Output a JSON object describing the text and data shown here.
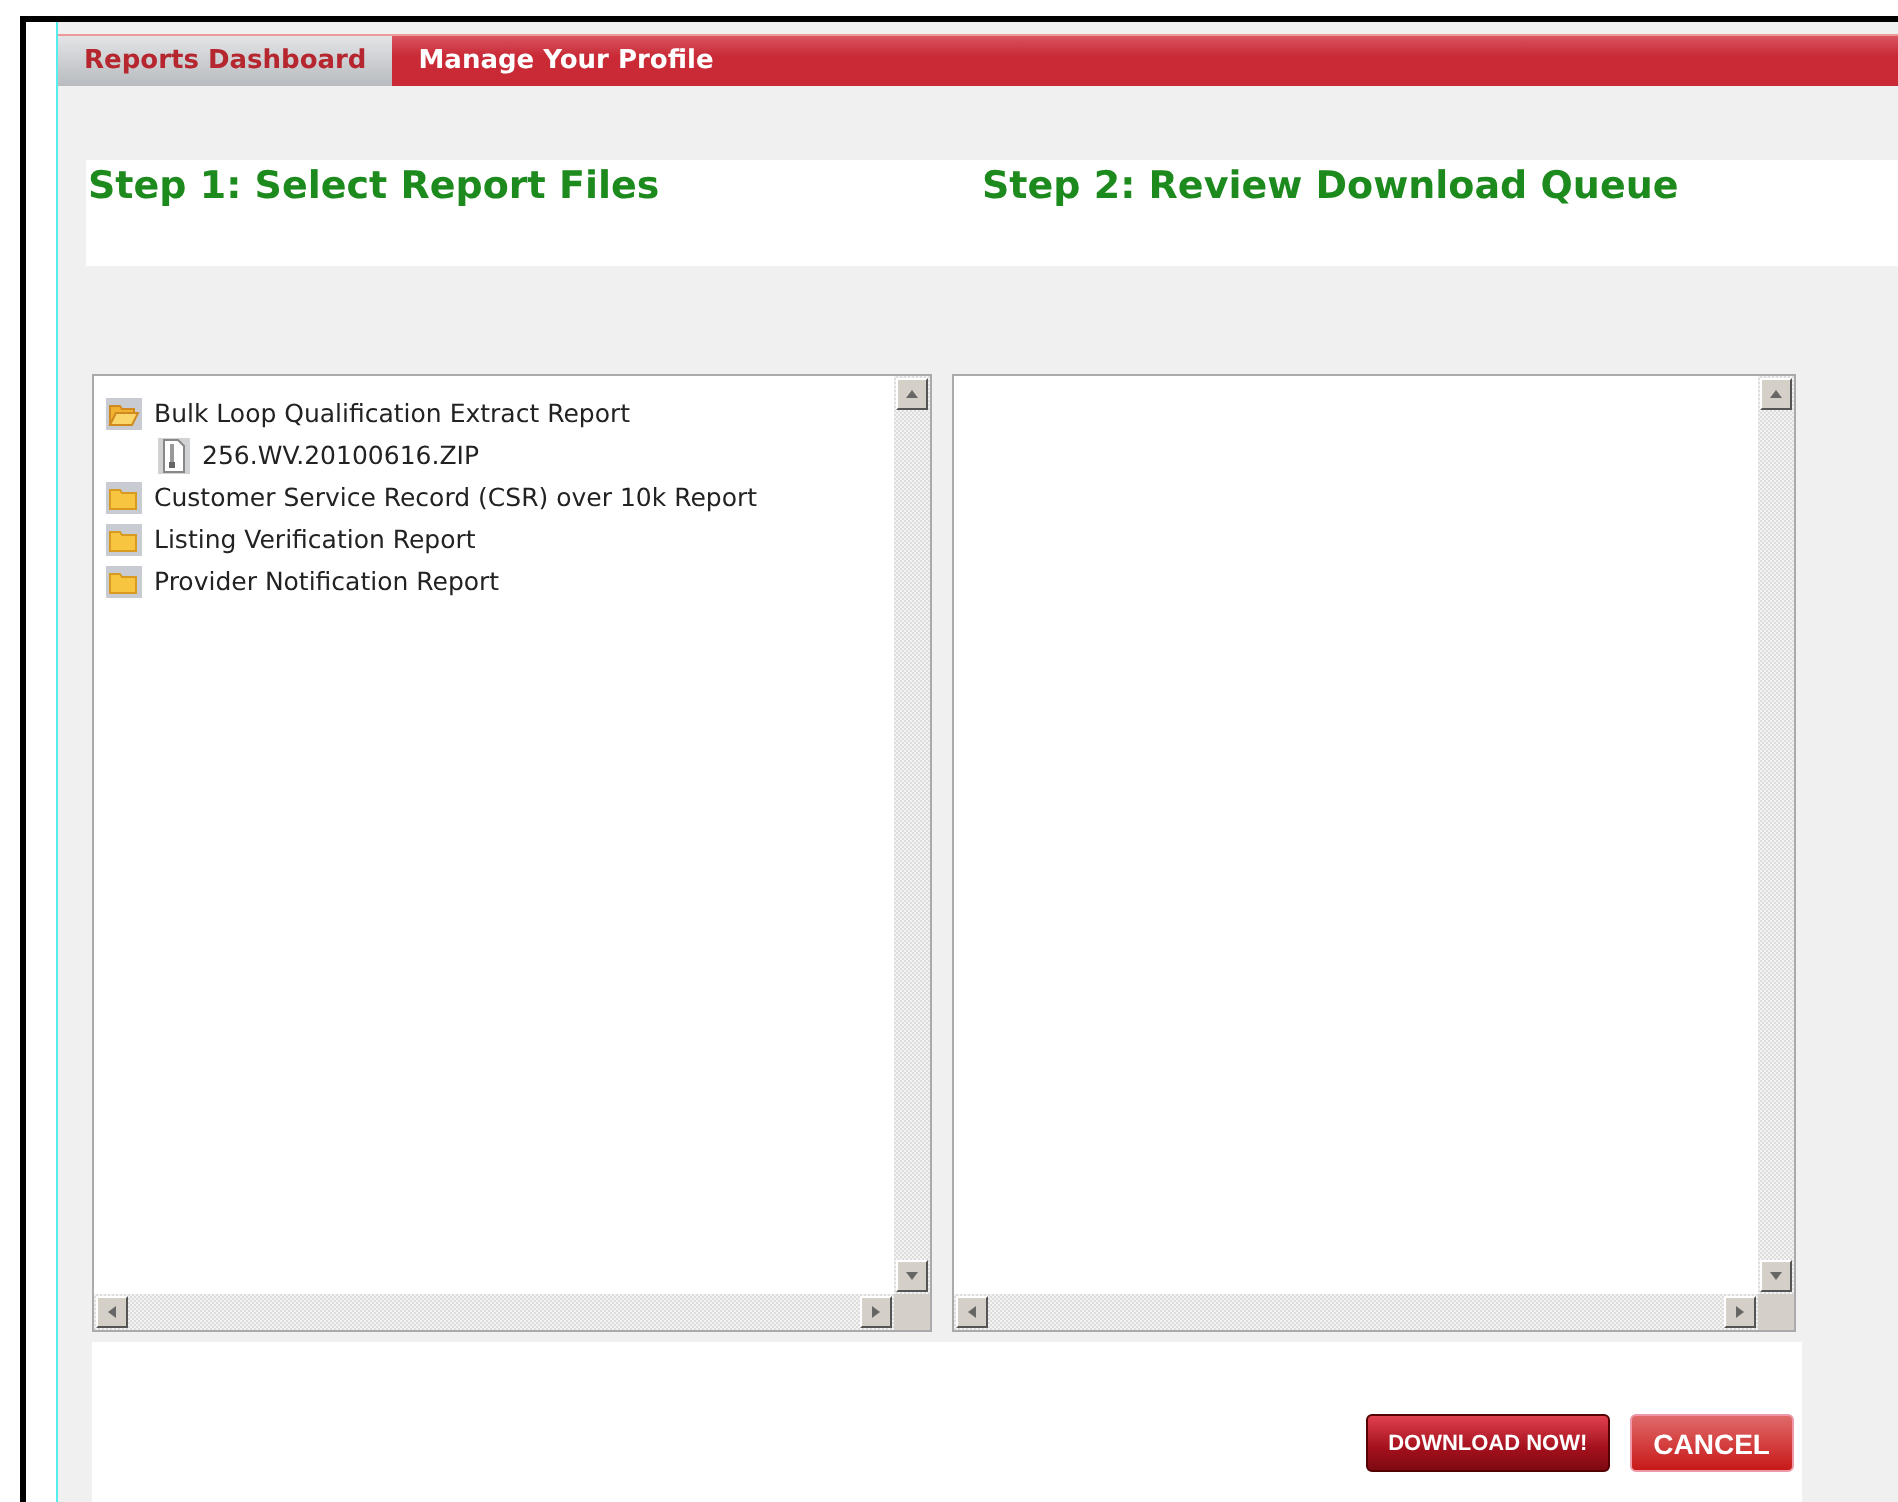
{
  "tabs": [
    {
      "label": "Reports Dashboard",
      "selected": true
    },
    {
      "label": "Manage Your Profile",
      "selected": false
    }
  ],
  "steps": [
    "Step 1: Select Report Files",
    "Step 2: Review Download Queue"
  ],
  "report_tree": [
    {
      "label": "Bulk Loop Qualification Extract Report",
      "kind": "folder",
      "expanded": true,
      "children": [
        {
          "label": "256.WV.20100616.ZIP",
          "kind": "file"
        }
      ]
    },
    {
      "label": "Customer Service Record (CSR) over 10k Report",
      "kind": "folder",
      "expanded": false
    },
    {
      "label": "Listing Verification Report",
      "kind": "folder",
      "expanded": false
    },
    {
      "label": "Provider Notification Report",
      "kind": "folder",
      "expanded": false
    }
  ],
  "buttons": [
    {
      "label": "DOWNLOAD NOW!",
      "kind": "primary"
    },
    {
      "label": "CANCEL",
      "kind": "secondary"
    }
  ]
}
